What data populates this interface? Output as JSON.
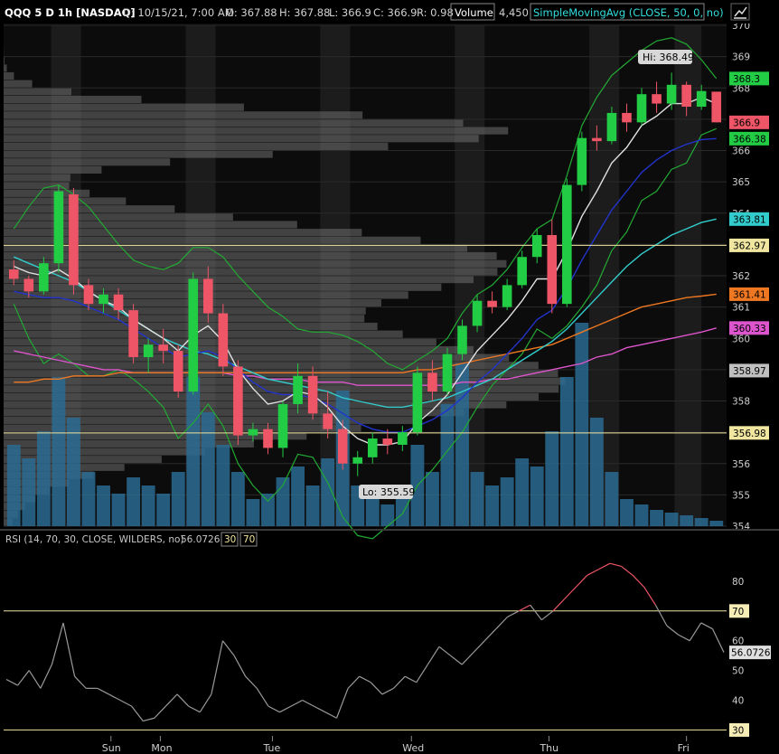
{
  "header": {
    "symbol": "QQQ 5 D 1h [NASDAQ]",
    "date": "D: 10/15/21, 7:00 AM",
    "open": "O: 367.88",
    "high": "H: 367.88",
    "low": "L: 366.9",
    "close": "C: 366.9",
    "range": "R: 0.98",
    "volume_label": "Volume",
    "volume_value": "4,450",
    "study": "SimpleMovingAvg (CLOSE, 50, 0, no)"
  },
  "rsi_header": {
    "label": "RSI (14, 70, 30, CLOSE, WILDERS, no)",
    "value": "56.0726",
    "ob": "30",
    "os": "70"
  },
  "annotations": {
    "hi": "Hi: 368.49",
    "lo": "Lo: 355.59"
  },
  "colors": {
    "up": "#22cc44",
    "down": "#ee5566",
    "volume": "#2a6a90",
    "sma_white": "#e0e0e0",
    "sma_blue": "#2233cc",
    "sma_cyan": "#33cccc",
    "sma_orange": "#ee7722",
    "sma_magenta": "#dd55cc",
    "band_green": "#22aa33",
    "level_line": "#f0e6a0",
    "rsi_line": "#9a9a9a",
    "rsi_hot": "#ee5566"
  },
  "chart_data": [
    {
      "type": "candlestick",
      "ylim": [
        354,
        370
      ],
      "y_ticks": [
        354,
        355,
        356,
        357,
        358,
        359,
        360,
        361,
        362,
        363,
        364,
        365,
        366,
        367,
        368,
        369,
        370
      ],
      "x_labels": [
        {
          "label": "Sun",
          "x": 6.5
        },
        {
          "label": "Mon",
          "x": 9.8
        },
        {
          "label": "Tue",
          "x": 17.3
        },
        {
          "label": "Wed",
          "x": 26.6
        },
        {
          "label": "Thu",
          "x": 35.8
        },
        {
          "label": "Fri",
          "x": 45.0
        }
      ],
      "session_bands": [
        [
          2.5,
          4.5
        ],
        [
          11.5,
          13.5
        ],
        [
          20.5,
          22.5
        ],
        [
          29.5,
          31.5
        ],
        [
          38.5,
          40.5
        ],
        [
          44.2,
          46
        ]
      ],
      "levels": [
        362.97,
        356.98
      ],
      "price_tags": [
        {
          "value": 368.3,
          "color": "#22cc44"
        },
        {
          "value": 366.9,
          "color": "#ee5566"
        },
        {
          "value": 366.38,
          "color": "#22cc44"
        },
        {
          "value": 363.81,
          "color": "#33cccc"
        },
        {
          "value": 362.97,
          "color": "#f0e6a0"
        },
        {
          "value": 361.41,
          "color": "#ee7722"
        },
        {
          "value": 360.33,
          "color": "#dd55cc"
        },
        {
          "value": 358.97,
          "color": "#c0c0c0"
        },
        {
          "value": 356.98,
          "color": "#f0e6a0"
        }
      ],
      "candles": [
        [
          362.2,
          362.5,
          361.7,
          361.9
        ],
        [
          361.9,
          362.0,
          361.3,
          361.5
        ],
        [
          361.5,
          362.6,
          361.4,
          362.4
        ],
        [
          362.4,
          364.9,
          362.1,
          364.7
        ],
        [
          364.6,
          364.8,
          361.4,
          361.7
        ],
        [
          361.7,
          361.9,
          360.9,
          361.1
        ],
        [
          361.1,
          361.6,
          360.8,
          361.4
        ],
        [
          361.4,
          361.6,
          360.6,
          360.9
        ],
        [
          360.9,
          361.1,
          359.2,
          359.4
        ],
        [
          359.4,
          360.0,
          358.9,
          359.8
        ],
        [
          359.8,
          360.3,
          359.2,
          359.6
        ],
        [
          359.6,
          359.8,
          358.1,
          358.3
        ],
        [
          358.3,
          362.1,
          358.2,
          361.9
        ],
        [
          361.9,
          362.3,
          360.5,
          360.8
        ],
        [
          360.8,
          361.1,
          358.8,
          359.1
        ],
        [
          359.1,
          359.3,
          356.6,
          356.9
        ],
        [
          356.9,
          357.3,
          356.7,
          357.1
        ],
        [
          357.1,
          357.3,
          356.3,
          356.5
        ],
        [
          356.5,
          358.0,
          356.2,
          357.9
        ],
        [
          357.9,
          359.2,
          357.6,
          358.8
        ],
        [
          358.8,
          359.1,
          357.4,
          357.6
        ],
        [
          357.6,
          358.3,
          356.8,
          357.1
        ],
        [
          357.1,
          357.4,
          355.8,
          356.0
        ],
        [
          356.0,
          356.4,
          355.6,
          356.2
        ],
        [
          356.2,
          357.0,
          356.0,
          356.8
        ],
        [
          356.8,
          357.1,
          356.3,
          356.6
        ],
        [
          356.6,
          357.2,
          356.4,
          357.0
        ],
        [
          357.0,
          359.1,
          356.9,
          358.9
        ],
        [
          358.9,
          359.3,
          358.0,
          358.3
        ],
        [
          358.3,
          359.7,
          358.2,
          359.5
        ],
        [
          359.5,
          360.6,
          359.3,
          360.4
        ],
        [
          360.4,
          361.4,
          360.2,
          361.2
        ],
        [
          361.2,
          361.5,
          360.8,
          361.0
        ],
        [
          361.0,
          361.9,
          360.9,
          361.7
        ],
        [
          361.7,
          362.8,
          361.6,
          362.6
        ],
        [
          362.6,
          363.5,
          362.4,
          363.3
        ],
        [
          363.3,
          363.8,
          360.8,
          361.1
        ],
        [
          361.1,
          365.1,
          361.0,
          364.9
        ],
        [
          364.9,
          366.6,
          364.7,
          366.4
        ],
        [
          366.4,
          366.8,
          366.0,
          366.3
        ],
        [
          366.3,
          367.4,
          366.2,
          367.2
        ],
        [
          367.2,
          367.5,
          366.6,
          366.9
        ],
        [
          366.9,
          368.0,
          366.8,
          367.8
        ],
        [
          367.8,
          368.2,
          367.2,
          367.5
        ],
        [
          367.5,
          368.49,
          367.3,
          368.1
        ],
        [
          368.1,
          368.2,
          367.1,
          367.4
        ],
        [
          367.4,
          368.1,
          367.3,
          367.9
        ],
        [
          367.88,
          367.88,
          366.9,
          366.9
        ]
      ],
      "volume": [
        0.3,
        0.25,
        0.35,
        0.55,
        0.4,
        0.2,
        0.15,
        0.12,
        0.18,
        0.15,
        0.12,
        0.2,
        0.55,
        0.42,
        0.3,
        0.2,
        0.1,
        0.12,
        0.18,
        0.22,
        0.15,
        0.25,
        0.5,
        0.15,
        0.1,
        0.08,
        0.1,
        0.3,
        0.2,
        0.45,
        0.6,
        0.2,
        0.15,
        0.18,
        0.25,
        0.22,
        0.35,
        0.55,
        0.75,
        0.4,
        0.2,
        0.1,
        0.08,
        0.06,
        0.05,
        0.04,
        0.03,
        0.02
      ],
      "sma": [
        {
          "color": "#e0e0e0",
          "values": [
            362.3,
            362.1,
            362.0,
            362.2,
            361.9,
            361.5,
            361.2,
            361.0,
            360.6,
            360.3,
            360.0,
            359.6,
            360.1,
            360.4,
            359.9,
            359.0,
            358.4,
            357.9,
            358.0,
            358.3,
            358.2,
            357.8,
            357.2,
            356.8,
            356.6,
            356.6,
            356.7,
            357.3,
            357.7,
            358.2,
            358.9,
            359.6,
            360.1,
            360.6,
            361.2,
            361.9,
            361.9,
            362.8,
            363.9,
            364.7,
            365.6,
            366.1,
            366.8,
            367.1,
            367.5,
            367.5,
            367.7,
            367.5
          ]
        },
        {
          "color": "#2233cc",
          "values": [
            361.5,
            361.4,
            361.3,
            361.3,
            361.2,
            361.0,
            360.8,
            360.6,
            360.3,
            360.0,
            359.7,
            359.4,
            359.5,
            359.6,
            359.4,
            359.0,
            358.6,
            358.3,
            358.2,
            358.2,
            358.1,
            357.9,
            357.6,
            357.3,
            357.1,
            357.0,
            357.0,
            357.2,
            357.4,
            357.7,
            358.1,
            358.6,
            359.0,
            359.5,
            360.0,
            360.6,
            360.9,
            361.6,
            362.5,
            363.3,
            364.1,
            364.7,
            365.3,
            365.7,
            366.0,
            366.2,
            366.35,
            366.38
          ]
        },
        {
          "color": "#33cccc",
          "values": [
            362.6,
            362.4,
            362.2,
            362.0,
            361.8,
            361.5,
            361.2,
            360.9,
            360.6,
            360.3,
            360.0,
            359.8,
            359.6,
            359.5,
            359.3,
            359.1,
            358.9,
            358.7,
            358.6,
            358.5,
            358.4,
            358.3,
            358.1,
            358.0,
            357.9,
            357.8,
            357.8,
            357.9,
            358.0,
            358.1,
            358.3,
            358.5,
            358.7,
            359.0,
            359.3,
            359.6,
            359.9,
            360.3,
            360.8,
            361.3,
            361.8,
            362.3,
            362.7,
            363.0,
            363.3,
            363.5,
            363.7,
            363.81
          ]
        },
        {
          "color": "#ee7722",
          "values": [
            358.6,
            358.6,
            358.7,
            358.7,
            358.8,
            358.8,
            358.8,
            358.9,
            358.9,
            358.9,
            358.9,
            358.9,
            358.9,
            358.9,
            358.9,
            358.9,
            358.9,
            358.9,
            358.9,
            358.9,
            358.9,
            358.9,
            358.9,
            358.9,
            358.9,
            358.9,
            358.9,
            359.0,
            359.0,
            359.1,
            359.2,
            359.3,
            359.4,
            359.5,
            359.6,
            359.7,
            359.8,
            360.0,
            360.2,
            360.4,
            360.6,
            360.8,
            361.0,
            361.1,
            361.2,
            361.3,
            361.35,
            361.41
          ]
        },
        {
          "color": "#dd55cc",
          "values": [
            359.6,
            359.5,
            359.4,
            359.3,
            359.2,
            359.1,
            359.0,
            359.0,
            358.9,
            358.9,
            358.9,
            358.9,
            358.9,
            358.9,
            358.9,
            358.8,
            358.8,
            358.7,
            358.7,
            358.7,
            358.6,
            358.6,
            358.6,
            358.5,
            358.5,
            358.5,
            358.5,
            358.5,
            358.5,
            358.5,
            358.6,
            358.6,
            358.7,
            358.7,
            358.8,
            358.9,
            359.0,
            359.1,
            359.2,
            359.4,
            359.5,
            359.7,
            359.8,
            359.9,
            360.0,
            360.1,
            360.2,
            360.33
          ]
        }
      ],
      "band_upper": [
        363.5,
        364.2,
        364.8,
        364.9,
        364.6,
        364.2,
        363.6,
        363.0,
        362.5,
        362.3,
        362.2,
        362.4,
        362.9,
        362.9,
        362.6,
        362.0,
        361.5,
        361.0,
        360.7,
        360.3,
        360.2,
        360.2,
        360.1,
        359.9,
        359.6,
        359.2,
        359.0,
        359.3,
        359.6,
        360.0,
        360.8,
        361.4,
        361.7,
        362.2,
        362.9,
        363.5,
        363.8,
        365.2,
        366.8,
        367.7,
        368.4,
        368.8,
        369.2,
        369.5,
        369.6,
        369.4,
        368.9,
        368.3
      ]
    },
    {
      "type": "line",
      "name": "RSI",
      "ylim": [
        28,
        90
      ],
      "y_ticks": [
        30,
        40,
        50,
        60,
        70,
        80
      ],
      "levels": [
        70,
        30
      ],
      "values": [
        47,
        45,
        50,
        44,
        52,
        66,
        48,
        44,
        44,
        42,
        40,
        38,
        33,
        34,
        38,
        42,
        38,
        36,
        42,
        60,
        55,
        48,
        44,
        38,
        36,
        38,
        40,
        38,
        36,
        34,
        44,
        48,
        46,
        42,
        44,
        48,
        46,
        52,
        58,
        55,
        52,
        56,
        60,
        64,
        68,
        70,
        72,
        67,
        70,
        74,
        78,
        82,
        84,
        86,
        85,
        82,
        78,
        72,
        65,
        62,
        60,
        66,
        64,
        56.0726
      ]
    }
  ]
}
